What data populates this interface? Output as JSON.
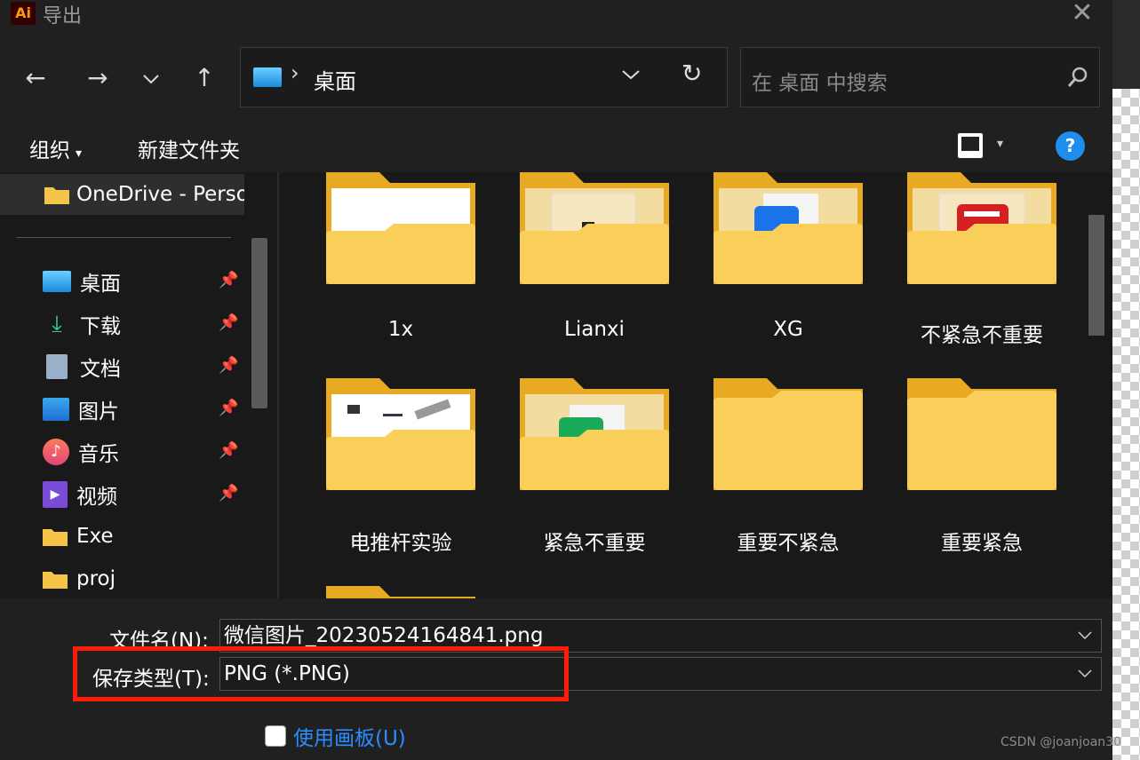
{
  "window": {
    "app_icon": "Ai",
    "title": "导出",
    "close": "✕"
  },
  "nav": {
    "back": "←",
    "forward": "→",
    "recent": "⌄",
    "up": "↑",
    "refresh": "↻"
  },
  "address": {
    "separator": "›",
    "path": "桌面"
  },
  "search": {
    "placeholder": "在 桌面 中搜索"
  },
  "toolbar": {
    "organize": "组织",
    "new_folder": "新建文件夹"
  },
  "sidebar": {
    "onedrive": "OneDrive - Perso",
    "items": [
      {
        "label": "桌面",
        "icon": "desktop-icon"
      },
      {
        "label": "下载",
        "icon": "download-icon"
      },
      {
        "label": "文档",
        "icon": "document-icon"
      },
      {
        "label": "图片",
        "icon": "picture-icon"
      },
      {
        "label": "音乐",
        "icon": "music-icon"
      },
      {
        "label": "视频",
        "icon": "video-icon"
      },
      {
        "label": "Exe",
        "icon": "folder-icon"
      },
      {
        "label": "proj",
        "icon": "folder-icon"
      }
    ]
  },
  "folders": [
    {
      "label": "1x"
    },
    {
      "label": "Lianxi"
    },
    {
      "label": "XG"
    },
    {
      "label": "不紧急不重要"
    },
    {
      "label": "电推杆实验"
    },
    {
      "label": "紧急不重要"
    },
    {
      "label": "重要不紧急"
    },
    {
      "label": "重要紧急"
    }
  ],
  "form": {
    "filename_label": "文件名(N):",
    "filename_value": "微信图片_20230524164841.png",
    "type_label": "保存类型(T):",
    "type_value": "PNG (*.PNG)",
    "use_artboards": "使用画板(U)"
  },
  "watermark": "CSDN @joanjoan30"
}
